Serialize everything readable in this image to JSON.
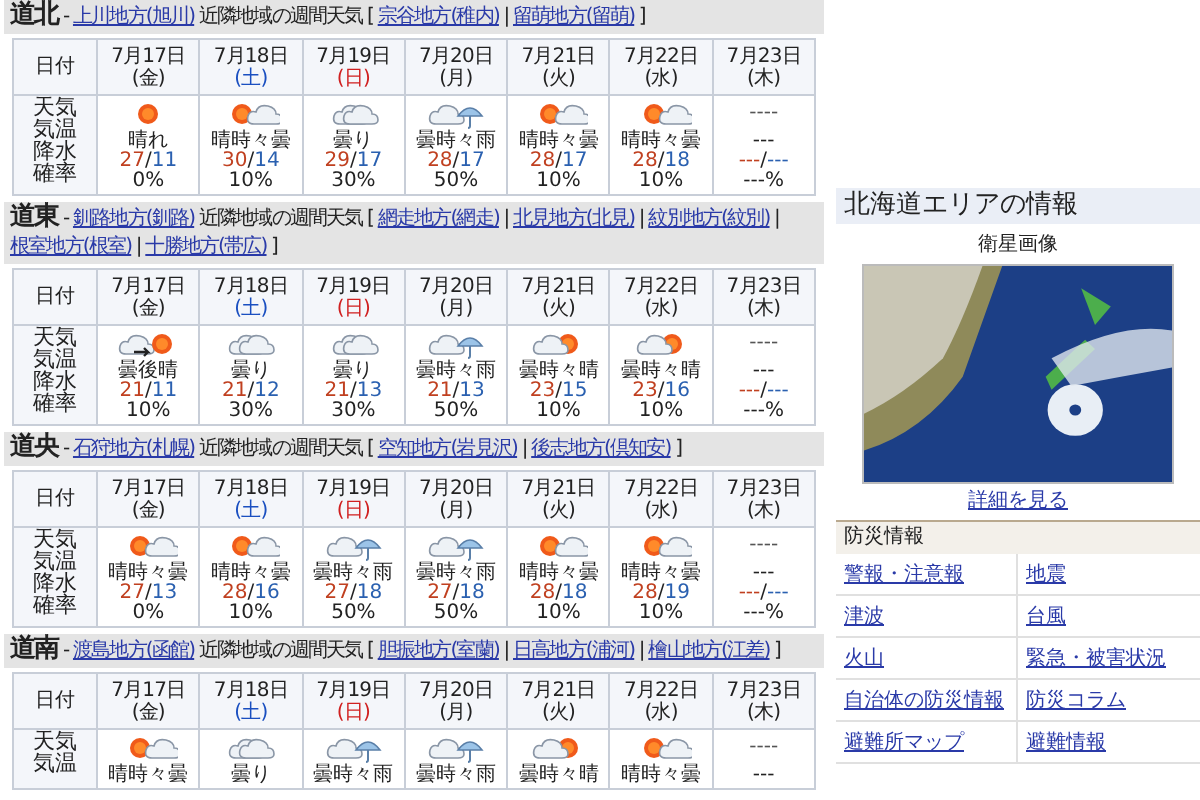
{
  "temp_separator": "/",
  "sections": [
    {
      "region": "道北",
      "dash": "-",
      "main_link": "上川地方(旭川)",
      "nearby_label": "近隣地域の週間天気 [",
      "nearby_links": [
        "宗谷地方(稚内)",
        "留萌地方(留萌)"
      ],
      "link_separator": "|",
      "close_bracket": "]",
      "date_header": "日付",
      "row_label": "天気気温降水確率",
      "days": [
        {
          "date": "7月17日",
          "weekday": "(金)",
          "color": "#222222",
          "kind": "sun",
          "weather": "晴れ",
          "high": "27",
          "low": "11",
          "pop": "0%"
        },
        {
          "date": "7月18日",
          "weekday": "(土)",
          "color": "#1a4fc0",
          "kind": "sun_cloud",
          "weather": "晴時々曇",
          "high": "30",
          "low": "14",
          "pop": "10%"
        },
        {
          "date": "7月19日",
          "weekday": "(日)",
          "color": "#d02020",
          "kind": "cloud",
          "weather": "曇り",
          "high": "29",
          "low": "17",
          "pop": "30%"
        },
        {
          "date": "7月20日",
          "weekday": "(月)",
          "color": "#222222",
          "kind": "cloud_rain",
          "weather": "曇時々雨",
          "high": "28",
          "low": "17",
          "pop": "50%"
        },
        {
          "date": "7月21日",
          "weekday": "(火)",
          "color": "#222222",
          "kind": "sun_cloud",
          "weather": "晴時々曇",
          "high": "28",
          "low": "17",
          "pop": "10%"
        },
        {
          "date": "7月22日",
          "weekday": "(水)",
          "color": "#222222",
          "kind": "sun_cloud",
          "weather": "晴時々曇",
          "high": "28",
          "low": "18",
          "pop": "10%"
        },
        {
          "date": "7月23日",
          "weekday": "(木)",
          "color": "#222222",
          "kind": "none",
          "icon_text": "----",
          "weather": "---",
          "high": "---",
          "low": "---",
          "pop": "---%"
        }
      ]
    },
    {
      "region": "道東",
      "dash": "-",
      "main_link": "釧路地方(釧路)",
      "nearby_label": "近隣地域の週間天気 [",
      "nearby_links": [
        "網走地方(網走)",
        "北見地方(北見)",
        "紋別地方(紋別)",
        "根室地方(根室)",
        "十勝地方(帯広)"
      ],
      "link_separator": "|",
      "close_bracket": "]",
      "date_header": "日付",
      "row_label": "天気気温降水確率",
      "days": [
        {
          "date": "7月17日",
          "weekday": "(金)",
          "color": "#222222",
          "kind": "cloud_then_sun",
          "weather": "曇後晴",
          "high": "21",
          "low": "11",
          "pop": "10%"
        },
        {
          "date": "7月18日",
          "weekday": "(土)",
          "color": "#1a4fc0",
          "kind": "cloud",
          "weather": "曇り",
          "high": "21",
          "low": "12",
          "pop": "30%"
        },
        {
          "date": "7月19日",
          "weekday": "(日)",
          "color": "#d02020",
          "kind": "cloud",
          "weather": "曇り",
          "high": "21",
          "low": "13",
          "pop": "30%"
        },
        {
          "date": "7月20日",
          "weekday": "(月)",
          "color": "#222222",
          "kind": "cloud_rain",
          "weather": "曇時々雨",
          "high": "21",
          "low": "13",
          "pop": "50%"
        },
        {
          "date": "7月21日",
          "weekday": "(火)",
          "color": "#222222",
          "kind": "cloud_sun",
          "weather": "曇時々晴",
          "high": "23",
          "low": "15",
          "pop": "10%"
        },
        {
          "date": "7月22日",
          "weekday": "(水)",
          "color": "#222222",
          "kind": "cloud_sun",
          "weather": "曇時々晴",
          "high": "23",
          "low": "16",
          "pop": "10%"
        },
        {
          "date": "7月23日",
          "weekday": "(木)",
          "color": "#222222",
          "kind": "none",
          "icon_text": "----",
          "weather": "---",
          "high": "---",
          "low": "---",
          "pop": "---%"
        }
      ]
    },
    {
      "region": "道央",
      "dash": "-",
      "main_link": "石狩地方(札幌)",
      "nearby_label": "近隣地域の週間天気 [",
      "nearby_links": [
        "空知地方(岩見沢)",
        "後志地方(倶知安)"
      ],
      "link_separator": "|",
      "close_bracket": "]",
      "date_header": "日付",
      "row_label": "天気気温降水確率",
      "days": [
        {
          "date": "7月17日",
          "weekday": "(金)",
          "color": "#222222",
          "kind": "sun_cloud",
          "weather": "晴時々曇",
          "high": "27",
          "low": "13",
          "pop": "0%"
        },
        {
          "date": "7月18日",
          "weekday": "(土)",
          "color": "#1a4fc0",
          "kind": "sun_cloud",
          "weather": "晴時々曇",
          "high": "28",
          "low": "16",
          "pop": "10%"
        },
        {
          "date": "7月19日",
          "weekday": "(日)",
          "color": "#d02020",
          "kind": "cloud_rain",
          "weather": "曇時々雨",
          "high": "27",
          "low": "18",
          "pop": "50%"
        },
        {
          "date": "7月20日",
          "weekday": "(月)",
          "color": "#222222",
          "kind": "cloud_rain",
          "weather": "曇時々雨",
          "high": "27",
          "low": "18",
          "pop": "50%"
        },
        {
          "date": "7月21日",
          "weekday": "(火)",
          "color": "#222222",
          "kind": "sun_cloud",
          "weather": "晴時々曇",
          "high": "28",
          "low": "18",
          "pop": "10%"
        },
        {
          "date": "7月22日",
          "weekday": "(水)",
          "color": "#222222",
          "kind": "sun_cloud",
          "weather": "晴時々曇",
          "high": "28",
          "low": "19",
          "pop": "10%"
        },
        {
          "date": "7月23日",
          "weekday": "(木)",
          "color": "#222222",
          "kind": "none",
          "icon_text": "----",
          "weather": "---",
          "high": "---",
          "low": "---",
          "pop": "---%"
        }
      ]
    },
    {
      "region": "道南",
      "dash": "-",
      "main_link": "渡島地方(函館)",
      "nearby_label": "近隣地域の週間天気 [",
      "nearby_links": [
        "胆振地方(室蘭)",
        "日高地方(浦河)",
        "檜山地方(江差)"
      ],
      "link_separator": "|",
      "close_bracket": "]",
      "date_header": "日付",
      "row_label": "天気気温",
      "days": [
        {
          "date": "7月17日",
          "weekday": "(金)",
          "color": "#222222",
          "kind": "sun_cloud",
          "weather": "晴時々曇"
        },
        {
          "date": "7月18日",
          "weekday": "(土)",
          "color": "#1a4fc0",
          "kind": "cloud",
          "weather": "曇り"
        },
        {
          "date": "7月19日",
          "weekday": "(日)",
          "color": "#d02020",
          "kind": "cloud_rain",
          "weather": "曇時々雨"
        },
        {
          "date": "7月20日",
          "weekday": "(月)",
          "color": "#222222",
          "kind": "cloud_rain",
          "weather": "曇時々雨"
        },
        {
          "date": "7月21日",
          "weekday": "(火)",
          "color": "#222222",
          "kind": "cloud_sun",
          "weather": "曇時々晴"
        },
        {
          "date": "7月22日",
          "weekday": "(水)",
          "color": "#222222",
          "kind": "sun_cloud",
          "weather": "晴時々曇"
        },
        {
          "date": "7月23日",
          "weekday": "(木)",
          "color": "#222222",
          "kind": "none",
          "icon_text": "----",
          "weather": "---"
        }
      ]
    }
  ],
  "area_info": {
    "title": "北海道エリアの情報",
    "satellite_caption": "衛星画像",
    "details_link": "詳細を見る"
  },
  "disaster_info": {
    "title": "防災情報",
    "links": [
      "警報・注意報",
      "地震",
      "津波",
      "台風",
      "火山",
      "緊急・被害状況",
      "自治体の防災情報",
      "防災コラム",
      "避難所マップ",
      "避難情報"
    ]
  }
}
